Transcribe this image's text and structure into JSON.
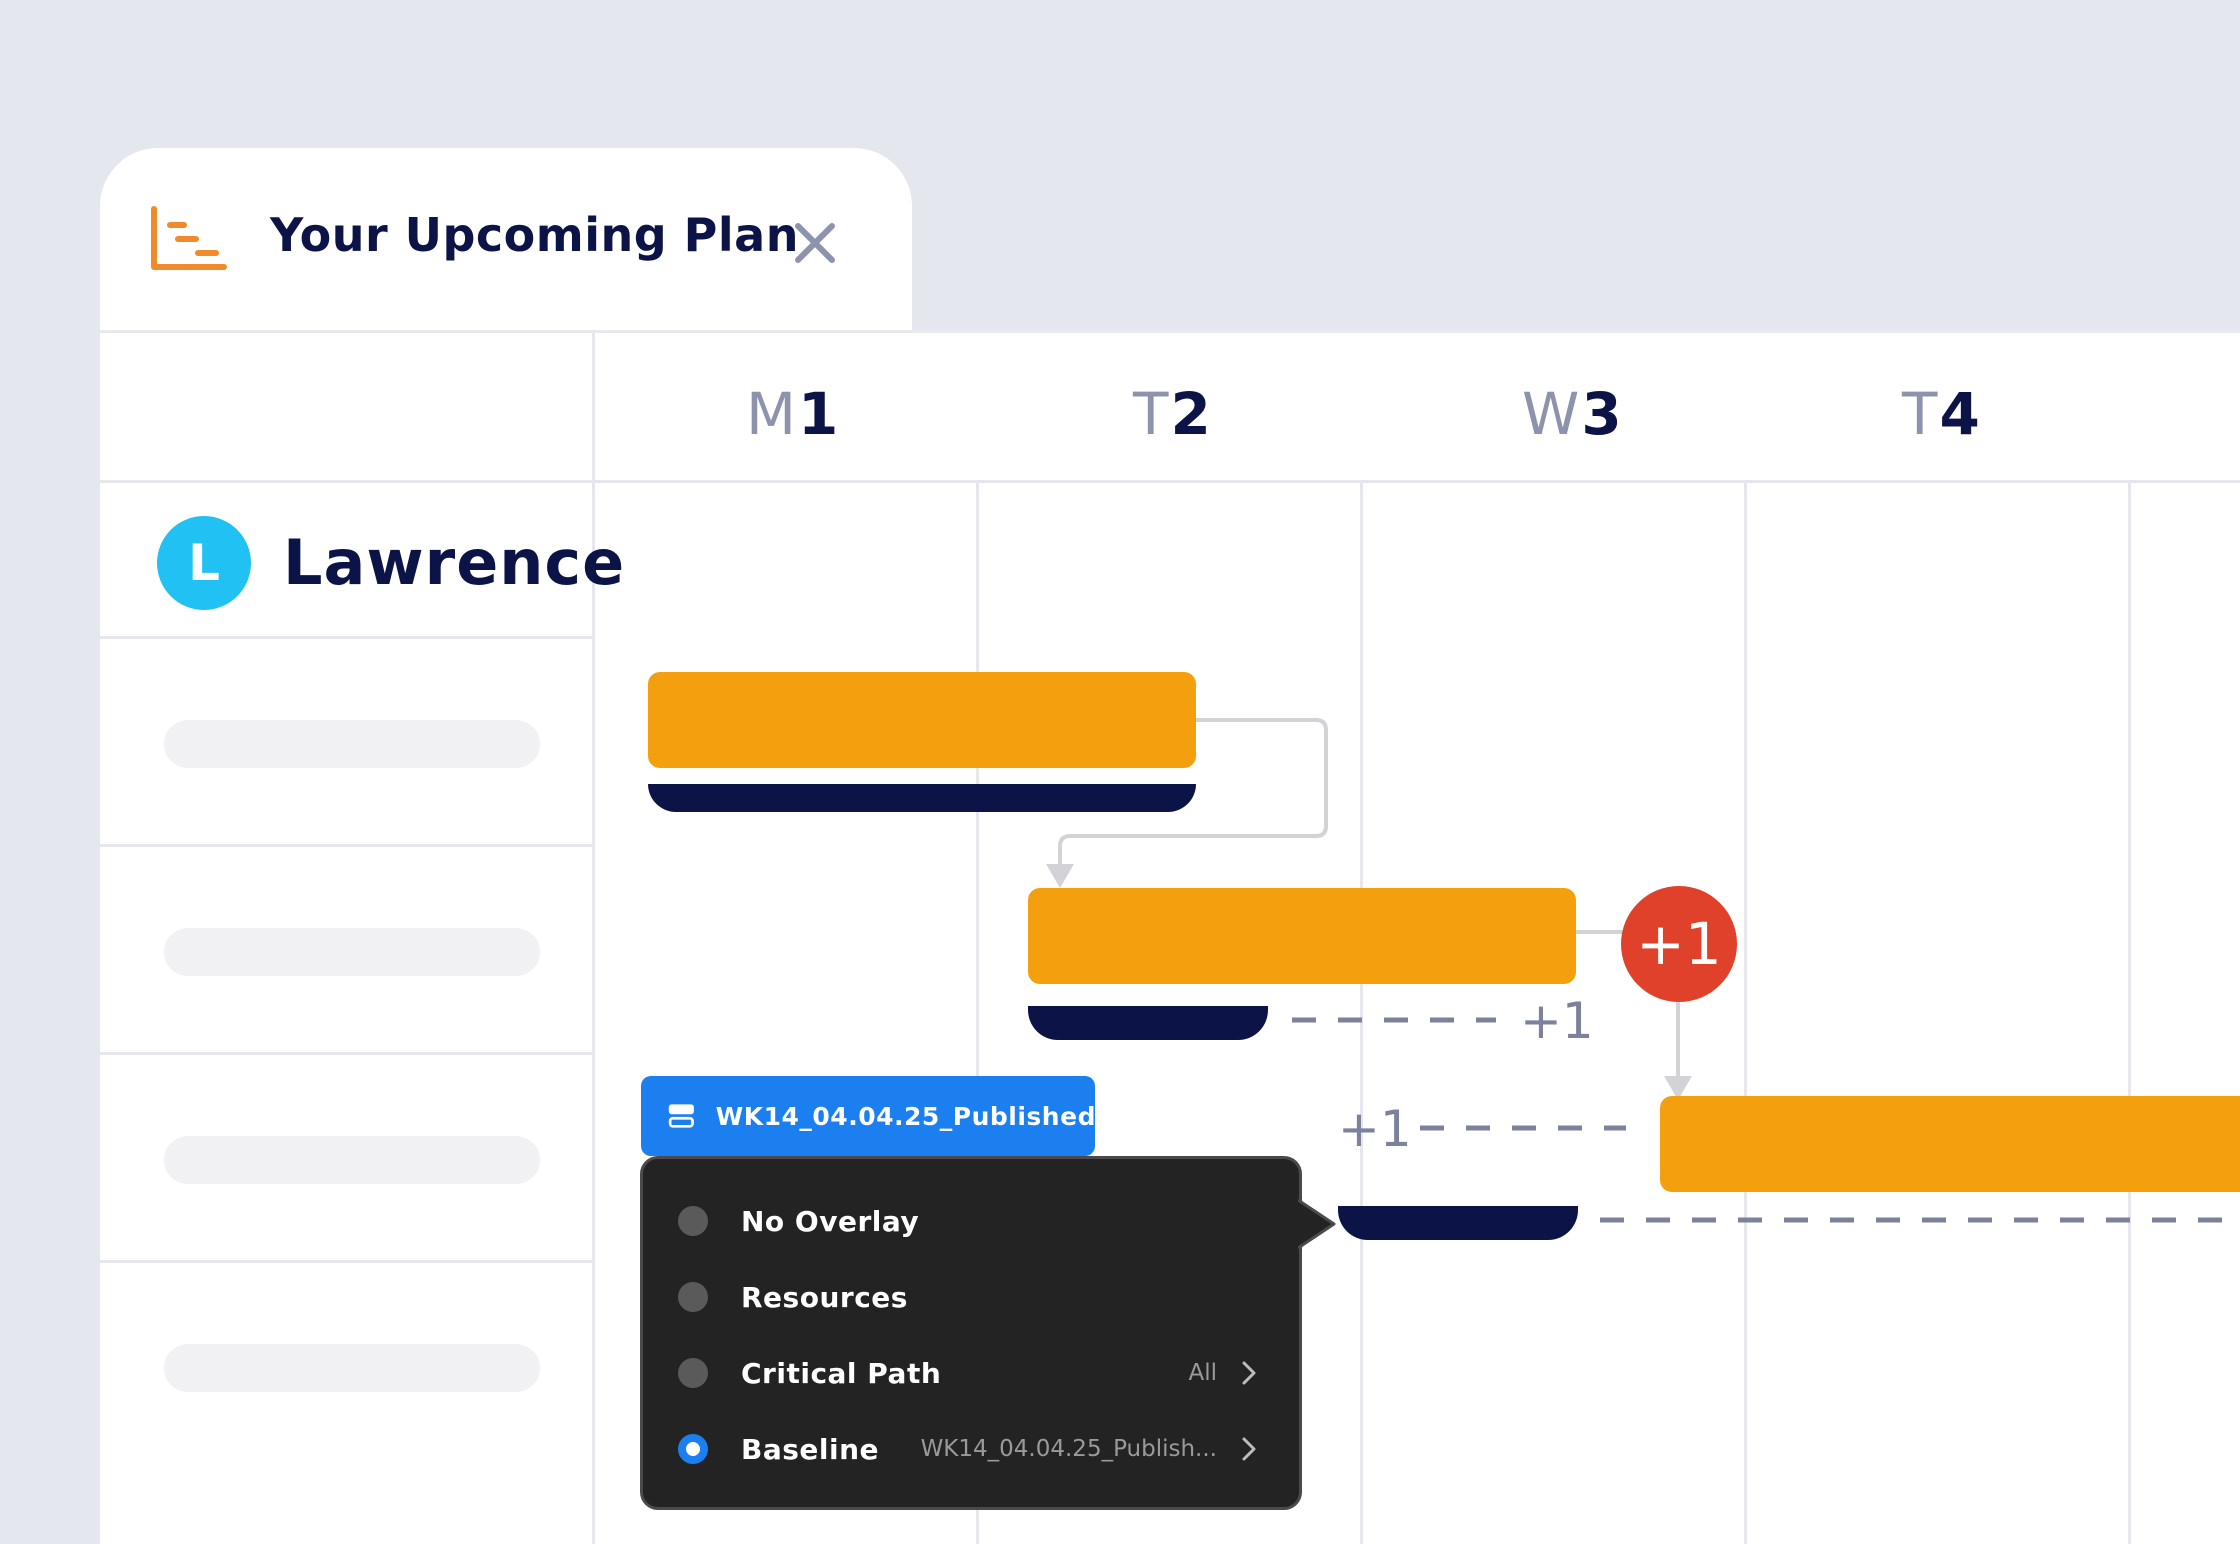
{
  "tab": {
    "title": "Your Upcoming Plan",
    "icon": "gantt-chart-icon",
    "close_icon": "close-icon"
  },
  "timeline": {
    "days": [
      {
        "letter": "M",
        "num": "1"
      },
      {
        "letter": "T",
        "num": "2"
      },
      {
        "letter": "W",
        "num": "3"
      },
      {
        "letter": "T",
        "num": "4"
      }
    ]
  },
  "resource": {
    "avatar_initial": "L",
    "name": "Lawrence",
    "avatar_color": "#21c1f4"
  },
  "gantt": {
    "task_color": "#f39f0e",
    "baseline_color": "#0c1447",
    "delay_badge": "+1",
    "delay_badge_color": "#e0412a",
    "variance_label_1": "+1",
    "variance_label_2": "+1"
  },
  "baseline_button": {
    "icon": "layers-icon",
    "label": "WK14_04.04.25_Published_...",
    "color": "#1b7ff0"
  },
  "overlay_menu": {
    "items": [
      {
        "label": "No Overlay",
        "value": "",
        "selected": false
      },
      {
        "label": "Resources",
        "value": "",
        "selected": false
      },
      {
        "label": "Critical Path",
        "value": "All",
        "selected": false
      },
      {
        "label": "Baseline",
        "value": "WK14_04.04.25_Publish...",
        "selected": true
      }
    ]
  }
}
